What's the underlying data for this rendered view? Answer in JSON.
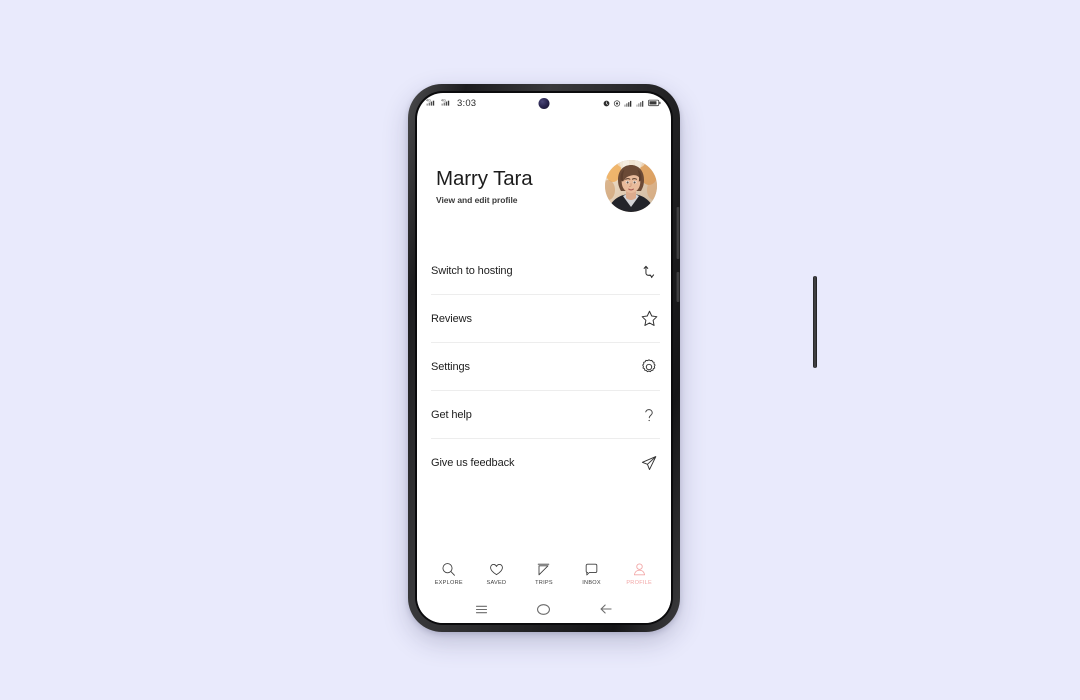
{
  "page": {
    "background_color": "#e9eafc",
    "device": "android-phone-mockup"
  },
  "status_bar": {
    "time": "3:03",
    "network_1": "4G",
    "network_2": "4G",
    "left_icons": [
      "signal-4g-icon",
      "signal-4g-icon"
    ],
    "right_icons": [
      "alarm-icon",
      "eye-icon",
      "signal-bars-icon",
      "signal-bars-icon",
      "battery-icon"
    ]
  },
  "profile": {
    "name": "Marry Tara",
    "subtitle": "View and edit profile",
    "avatar_alt": "user-profile-photo"
  },
  "menu": {
    "items": [
      {
        "label": "Switch to hosting",
        "icon": "swap-arrows-icon"
      },
      {
        "label": "Reviews",
        "icon": "star-outline-icon"
      },
      {
        "label": "Settings",
        "icon": "gear-icon"
      },
      {
        "label": "Get help",
        "icon": "question-mark-icon"
      },
      {
        "label": "Give us feedback",
        "icon": "paper-plane-icon"
      }
    ]
  },
  "tab_bar": {
    "active_index": 4,
    "active_color": "#f2a6a6",
    "inactive_color": "#3d3d3d",
    "tabs": [
      {
        "label": "EXPLORE",
        "icon": "search-icon"
      },
      {
        "label": "SAVED",
        "icon": "heart-icon"
      },
      {
        "label": "TRIPS",
        "icon": "pennant-flag-icon"
      },
      {
        "label": "INBOX",
        "icon": "speech-bubble-icon"
      },
      {
        "label": "PROFILE",
        "icon": "person-icon"
      }
    ]
  },
  "android_nav": {
    "buttons": [
      {
        "name": "recents",
        "icon": "hamburger-icon"
      },
      {
        "name": "home",
        "icon": "circle-icon"
      },
      {
        "name": "back",
        "icon": "arrow-left-icon"
      }
    ]
  }
}
